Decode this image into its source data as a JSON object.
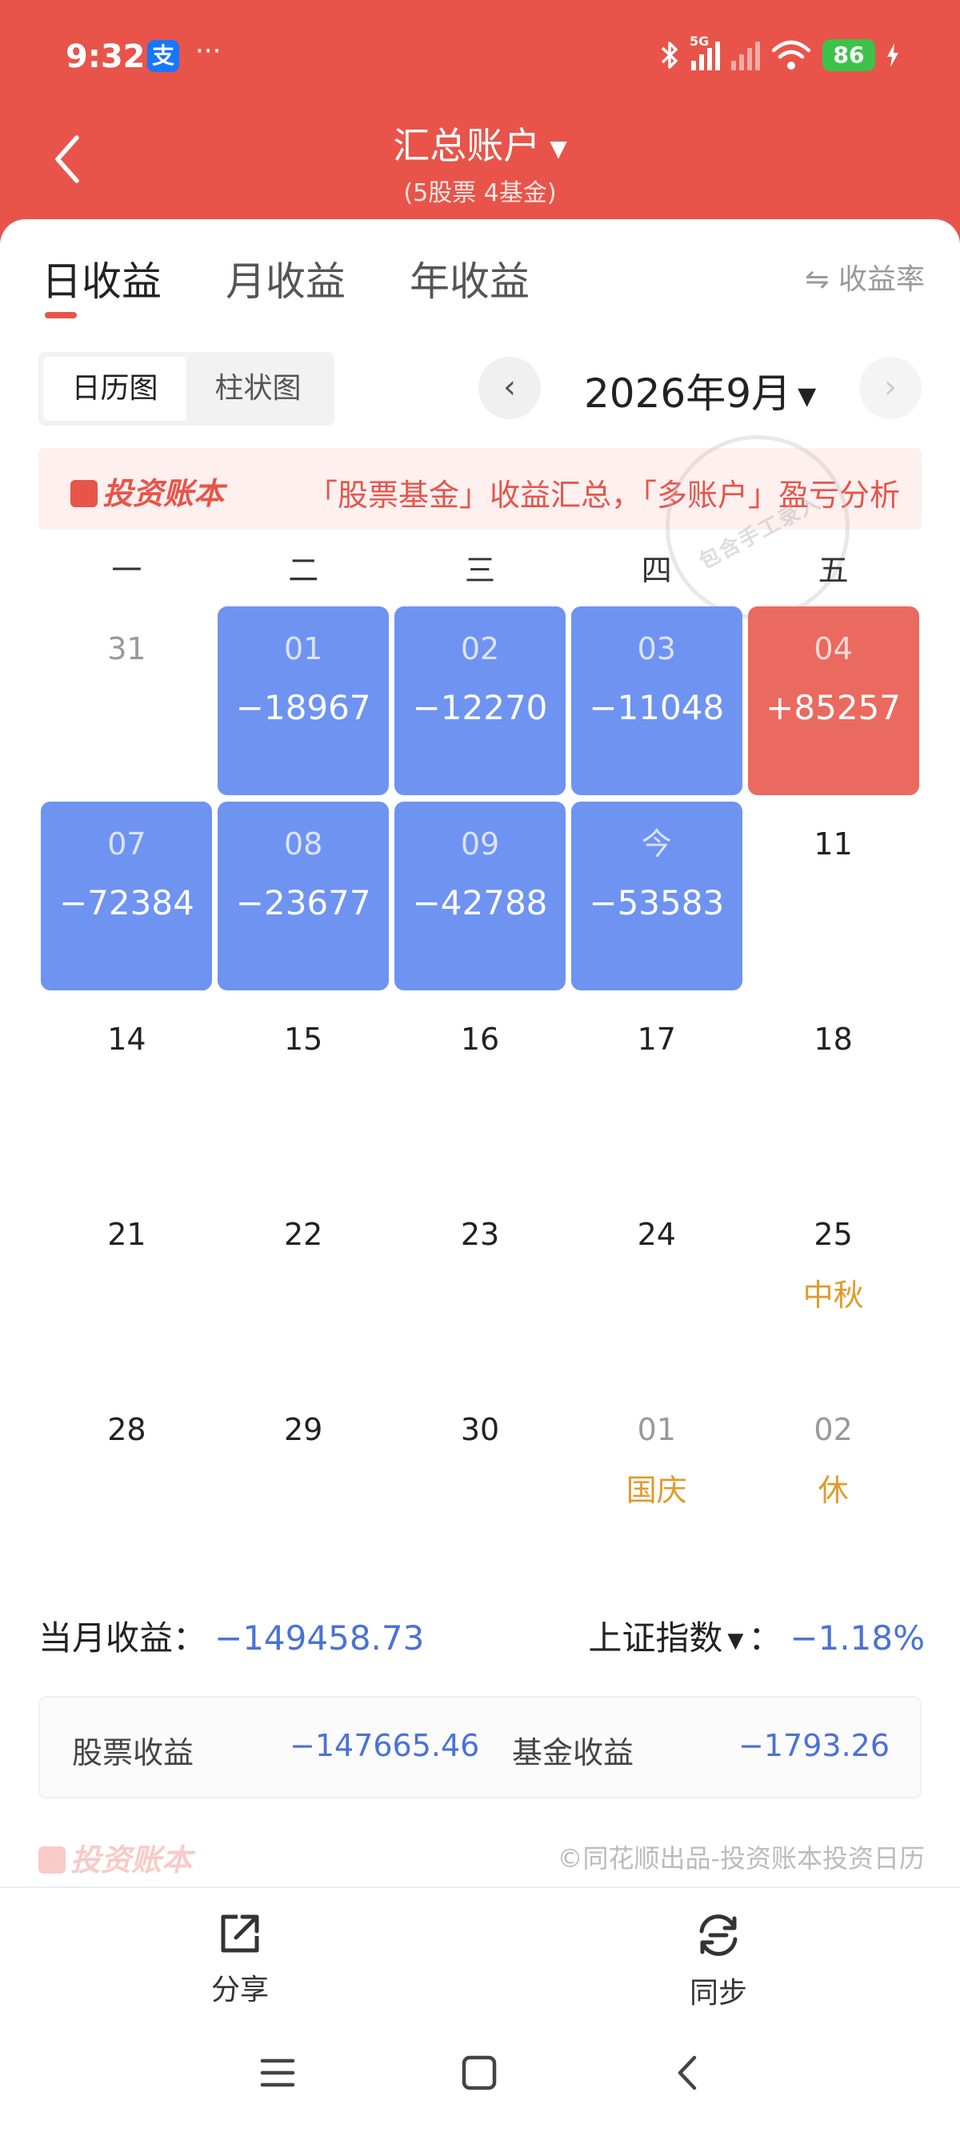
{
  "status_bar": {
    "time": "9:32",
    "app_icon_text": "支",
    "more": "···",
    "network_label": "5G",
    "battery": "86",
    "icons": [
      "alipay-icon",
      "bluetooth-icon",
      "signal-icon",
      "signal-no-service-icon",
      "wifi-icon",
      "battery-icon",
      "charging-icon"
    ]
  },
  "header": {
    "title": "汇总账户",
    "subtitle": "(5股票 4基金)",
    "dropdown_icon": "▼"
  },
  "tabs": [
    {
      "label": "日收益",
      "active": true
    },
    {
      "label": "月收益",
      "active": false
    },
    {
      "label": "年收益",
      "active": false
    }
  ],
  "rate_toggle": "⇋ 收益率",
  "view_switch": [
    {
      "label": "日历图",
      "active": true
    },
    {
      "label": "柱状图",
      "active": false
    }
  ],
  "month_nav": {
    "prev": "‹",
    "label": "2026年9月",
    "caret": "▼",
    "next": "›"
  },
  "promo": {
    "logo": "投资账本",
    "text": "「股票基金」收益汇总，「多账户」盈亏分析"
  },
  "stamp": {
    "text": "包含手工录入"
  },
  "weekdays": [
    "一",
    "二",
    "三",
    "四",
    "五"
  ],
  "calendar": [
    {
      "day": "31",
      "value": "",
      "note": "",
      "state": "muted"
    },
    {
      "day": "01",
      "value": "−18967",
      "note": "",
      "state": "loss"
    },
    {
      "day": "02",
      "value": "−12270",
      "note": "",
      "state": "loss"
    },
    {
      "day": "03",
      "value": "−11048",
      "note": "",
      "state": "loss"
    },
    {
      "day": "04",
      "value": "+85257",
      "note": "",
      "state": "gain"
    },
    {
      "day": "07",
      "value": "−72384",
      "note": "",
      "state": "loss"
    },
    {
      "day": "08",
      "value": "−23677",
      "note": "",
      "state": "loss"
    },
    {
      "day": "09",
      "value": "−42788",
      "note": "",
      "state": "loss"
    },
    {
      "day": "今",
      "value": "−53583",
      "note": "",
      "state": "loss"
    },
    {
      "day": "11",
      "value": "",
      "note": "",
      "state": "plain"
    },
    {
      "day": "14",
      "value": "",
      "note": "",
      "state": "plain"
    },
    {
      "day": "15",
      "value": "",
      "note": "",
      "state": "plain"
    },
    {
      "day": "16",
      "value": "",
      "note": "",
      "state": "plain"
    },
    {
      "day": "17",
      "value": "",
      "note": "",
      "state": "plain"
    },
    {
      "day": "18",
      "value": "",
      "note": "",
      "state": "plain"
    },
    {
      "day": "21",
      "value": "",
      "note": "",
      "state": "plain"
    },
    {
      "day": "22",
      "value": "",
      "note": "",
      "state": "plain"
    },
    {
      "day": "23",
      "value": "",
      "note": "",
      "state": "plain"
    },
    {
      "day": "24",
      "value": "",
      "note": "",
      "state": "plain"
    },
    {
      "day": "25",
      "value": "",
      "note": "中秋",
      "state": "plain"
    },
    {
      "day": "28",
      "value": "",
      "note": "",
      "state": "plain"
    },
    {
      "day": "29",
      "value": "",
      "note": "",
      "state": "plain"
    },
    {
      "day": "30",
      "value": "",
      "note": "",
      "state": "plain"
    },
    {
      "day": "01",
      "value": "",
      "note": "国庆",
      "state": "muted"
    },
    {
      "day": "02",
      "value": "",
      "note": "休",
      "state": "muted"
    }
  ],
  "summary": {
    "month_label": "当月收益：",
    "month_value": "−149458.73",
    "index_label": "上证指数",
    "index_caret": "▼",
    "index_sep": "：",
    "index_value": "−1.18%"
  },
  "breakdown": {
    "stock_label": "股票收益",
    "stock_value": "−147665.46",
    "fund_label": "基金收益",
    "fund_value": "−1793.26"
  },
  "footer": {
    "logo": "投资账本",
    "credit": "©同花顺出品-投资账本投资日历"
  },
  "actions": [
    {
      "label": "分享",
      "icon": "share-icon"
    },
    {
      "label": "同步",
      "icon": "sync-icon"
    }
  ],
  "colors": {
    "brand_red": "#e8544a",
    "loss_blue": "#6f93f1",
    "gain_red": "#ea6a5f",
    "value_blue": "#4a72d6",
    "holiday_orange": "#e19a2c"
  }
}
